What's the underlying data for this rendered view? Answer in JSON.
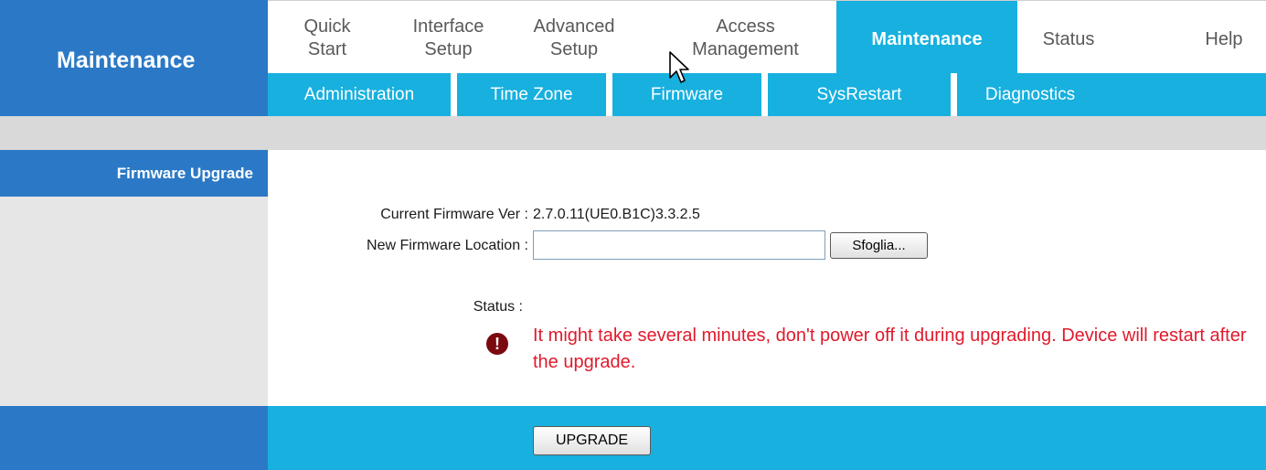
{
  "header": {
    "brand_title": "Maintenance"
  },
  "topnav": {
    "items": [
      {
        "line1": "Quick",
        "line2": "Start"
      },
      {
        "line1": "Interface",
        "line2": "Setup"
      },
      {
        "line1": "Advanced",
        "line2": "Setup"
      },
      {
        "line1": "Access",
        "line2": "Management"
      },
      {
        "label": "Maintenance"
      },
      {
        "label": "Status"
      },
      {
        "label": "Help"
      }
    ]
  },
  "subnav": {
    "items": [
      "Administration",
      "Time Zone",
      "Firmware",
      "SysRestart",
      "Diagnostics"
    ]
  },
  "sidebar": {
    "section_title": "Firmware Upgrade"
  },
  "form": {
    "current_fw_label": "Current Firmware Ver :",
    "current_fw_value": "2.7.0.11(UE0.B1C)3.3.2.5",
    "new_fw_label": "New Firmware Location :",
    "new_fw_value": "",
    "browse_label": "Sfoglia...",
    "status_label": "Status :",
    "warning_text": "It might take several minutes, don't power off it during upgrading. Device will restart after the upgrade."
  },
  "footer": {
    "upgrade_label": "UPGRADE"
  },
  "colors": {
    "brand_blue": "#2b79c6",
    "accent_cyan": "#17b0df",
    "warning_red": "#e01a2c"
  }
}
